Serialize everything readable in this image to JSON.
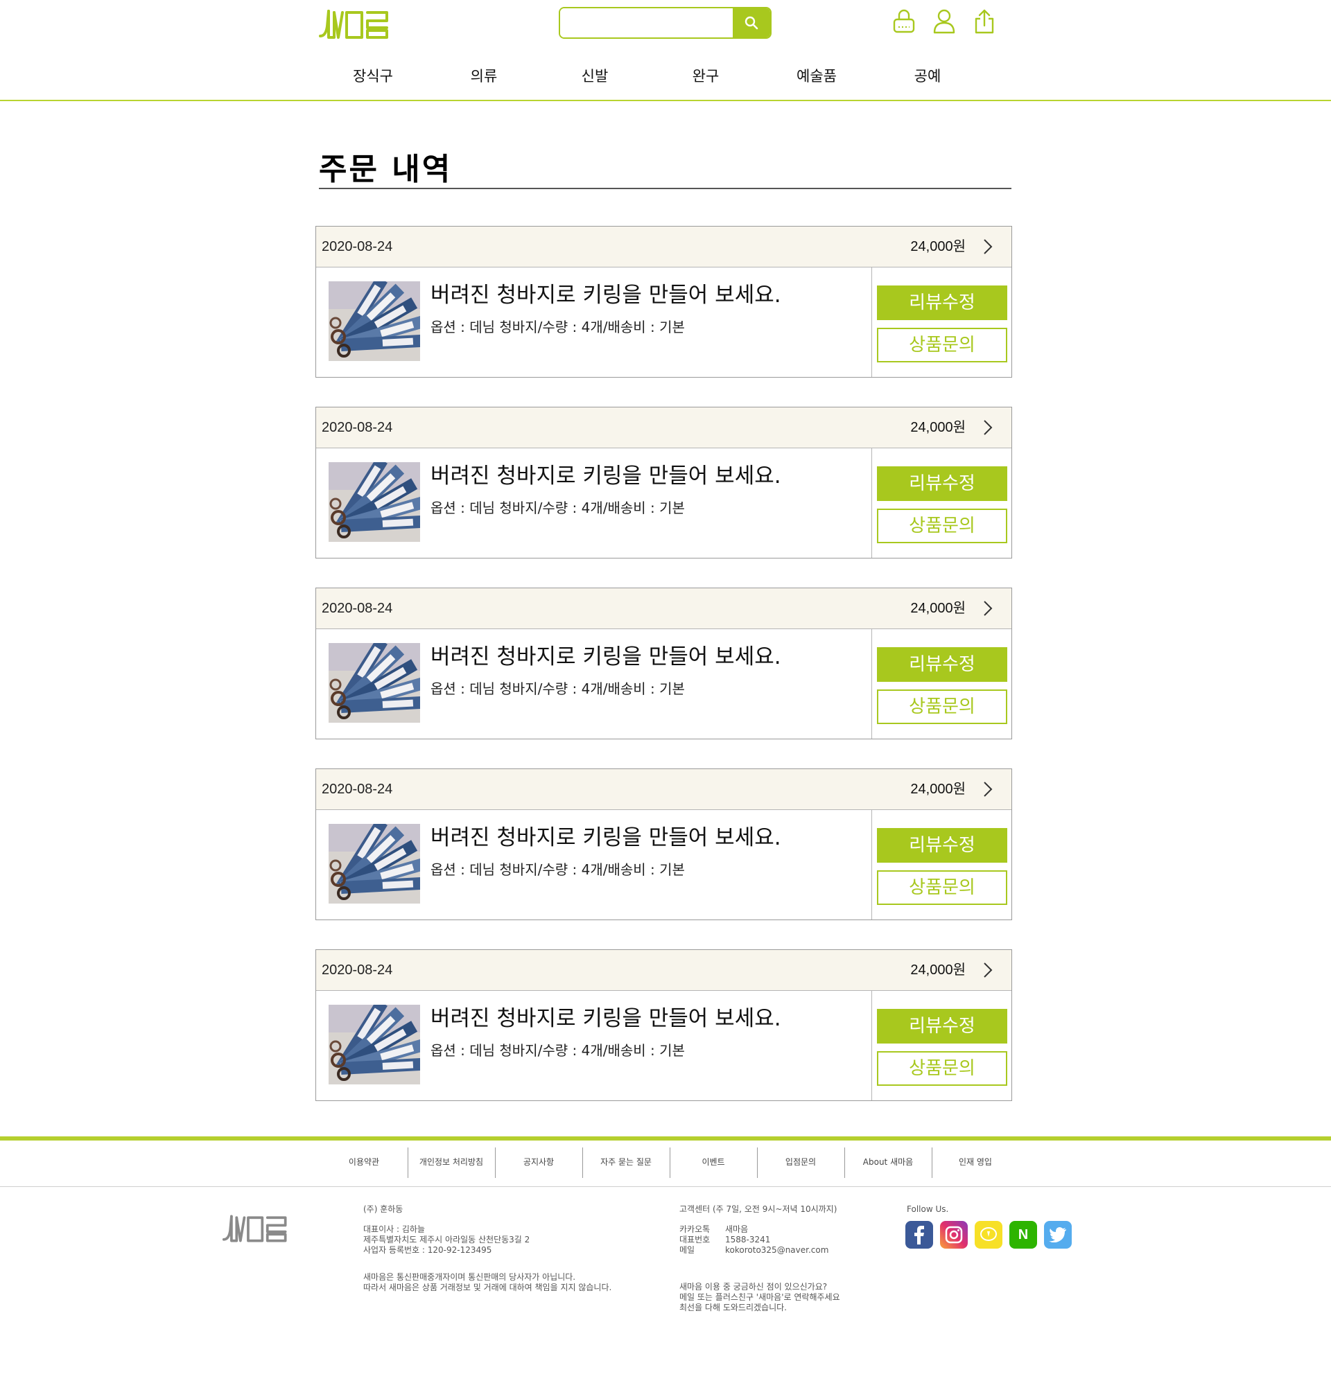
{
  "header": {
    "search_placeholder": "",
    "nav": [
      "장식구",
      "의류",
      "신발",
      "완구",
      "예술품",
      "공예"
    ]
  },
  "page": {
    "title": "주문 내역"
  },
  "orders": [
    {
      "date": "2020-08-24",
      "price": "24,000원",
      "product": "버려진 청바지로 키링을 만들어 보세요.",
      "option": "옵션 : 데님 청바지/수량 : 4개/배송비 : 기본",
      "review_label": "리뷰수정",
      "inquiry_label": "상품문의"
    },
    {
      "date": "2020-08-24",
      "price": "24,000원",
      "product": "버려진 청바지로 키링을 만들어 보세요.",
      "option": "옵션 : 데님 청바지/수량 : 4개/배송비 : 기본",
      "review_label": "리뷰수정",
      "inquiry_label": "상품문의"
    },
    {
      "date": "2020-08-24",
      "price": "24,000원",
      "product": "버려진 청바지로 키링을 만들어 보세요.",
      "option": "옵션 : 데님 청바지/수량 : 4개/배송비 : 기본",
      "review_label": "리뷰수정",
      "inquiry_label": "상품문의"
    },
    {
      "date": "2020-08-24",
      "price": "24,000원",
      "product": "버려진 청바지로 키링을 만들어 보세요.",
      "option": "옵션 : 데님 청바지/수량 : 4개/배송비 : 기본",
      "review_label": "리뷰수정",
      "inquiry_label": "상품문의"
    },
    {
      "date": "2020-08-24",
      "price": "24,000원",
      "product": "버려진 청바지로 키링을 만들어 보세요.",
      "option": "옵션 : 데님 청바지/수량 : 4개/배송비 : 기본",
      "review_label": "리뷰수정",
      "inquiry_label": "상품문의"
    }
  ],
  "footer": {
    "links": [
      "이용약관",
      "개인정보 처리방침",
      "공지사항",
      "자주 묻는 질문",
      "이벤트",
      "입점문의",
      "About 새마음",
      "인재 영입"
    ],
    "company": {
      "name": "(주) 훈하동",
      "ceo": "대표이사 : 김하늘",
      "address": "제주특별자치도 제주시 아라일동 산천단동3길 2",
      "biz_no": "사업자 등록번호 : 120-92-123495",
      "notice1": "새마음은 통신판매중개자이며 통신판매의 당사자가 아닙니다.",
      "notice2": "따라서 새마음은 상품 거래정보 및 거래에 대하여 책임을 지지 않습니다."
    },
    "service": {
      "title": "고객센터 (주 7일, 오전 9시~저녁 10시까지)",
      "kakao_label": "카카오톡",
      "kakao_value": "새마음",
      "phone_label": "대표번호",
      "phone_value": "1588-3241",
      "mail_label": "메일",
      "mail_value": "kokoroto325@naver.com",
      "q1": "새마음 이용 중 궁금하신 점이 있으신가요?",
      "q2": "메일 또는 플러스친구 '새마음'로 연락해주세요",
      "q3": "최선을 다해 도와드리겠습니다."
    },
    "follow": "Follow Us.",
    "social_n": "N",
    "social": [
      "facebook-icon",
      "instagram-icon",
      "kakaotalk-icon",
      "naver-icon",
      "twitter-icon"
    ]
  },
  "colors": {
    "accent": "#a8c81e",
    "header_bg": "#f8f5ec",
    "border": "#9a9a9a"
  }
}
